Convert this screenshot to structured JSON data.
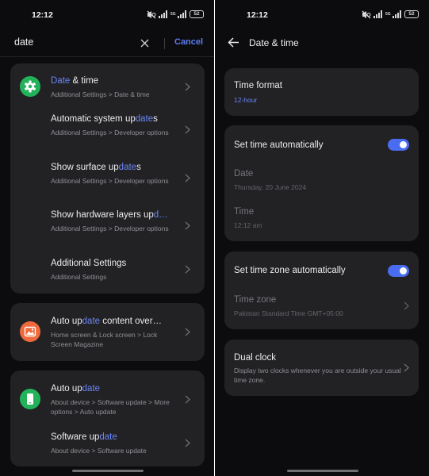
{
  "status_bar": {
    "time": "12:12",
    "battery": "52",
    "network": "5G"
  },
  "left": {
    "search": {
      "value": "date",
      "cancel_label": "Cancel"
    },
    "results": [
      {
        "pre": "",
        "hl": "Date",
        "post": " & time",
        "subtitle": "Additional Settings > Date & time",
        "icon": "gear-icon",
        "icon_color": "#22b35a"
      },
      {
        "pre": "Automatic system up",
        "hl": "date",
        "post": "s",
        "subtitle": "Additional Settings > Developer options"
      },
      {
        "pre": "Show surface up",
        "hl": "date",
        "post": "s",
        "subtitle": "Additional Settings > Developer options"
      },
      {
        "pre": "Show hardware layers up",
        "hl": "d…",
        "post": "",
        "subtitle": "Additional Settings > Developer options"
      },
      {
        "pre": "Additional Settings",
        "hl": "",
        "post": "",
        "subtitle": "Additional Settings"
      },
      {
        "pre": "Auto up",
        "hl": "date",
        "post": " content over…",
        "subtitle": "Home screen & Lock screen > Lock Screen Magazine",
        "icon": "image-icon",
        "icon_color": "#ee6a3c"
      },
      {
        "pre": "Auto up",
        "hl": "date",
        "post": "",
        "subtitle": "About device > Software update > More options > Auto update",
        "icon": "phone-icon",
        "icon_color": "#22b35a"
      },
      {
        "pre": "Software up",
        "hl": "date",
        "post": "",
        "subtitle": "About device > Software update"
      }
    ]
  },
  "right": {
    "header": {
      "title": "Date & time"
    },
    "time_format": {
      "label": "Time format",
      "value": "12-hour"
    },
    "set_time_auto": {
      "label": "Set time automatically",
      "enabled": true
    },
    "date": {
      "label": "Date",
      "value": "Thursday, 20 June 2024"
    },
    "time": {
      "label": "Time",
      "value": "12:12 am"
    },
    "set_zone_auto": {
      "label": "Set time zone automatically",
      "enabled": true
    },
    "time_zone": {
      "label": "Time zone",
      "value": "Pakistan Standard Time GMT+05:00"
    },
    "dual_clock": {
      "label": "Dual clock",
      "description": "Display two clocks whenever you are outside your usual time zone."
    }
  },
  "colors": {
    "accent": "#5d7cf0",
    "background": "#0c0c0e",
    "card": "#222225",
    "toggle_on": "#4a6cf0"
  }
}
